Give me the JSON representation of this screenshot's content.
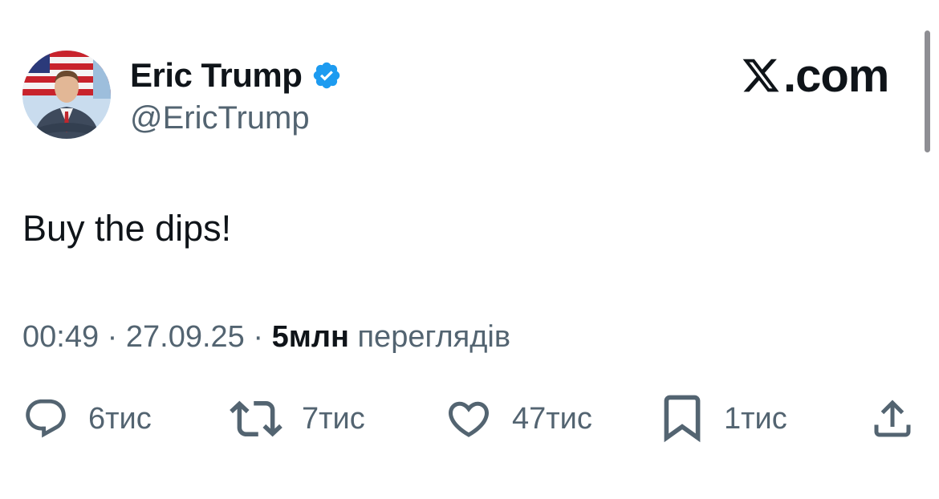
{
  "author": {
    "display_name": "Eric Trump",
    "handle": "@EricTrump",
    "verified": true
  },
  "brand": {
    "label": ".com"
  },
  "tweet": {
    "text": "Buy the dips!",
    "time": "00:49",
    "date": "27.09.25",
    "views_count": "5млн",
    "views_label": "переглядів",
    "separator": "·"
  },
  "actions": {
    "reply_count": "6тис",
    "retweet_count": "7тис",
    "like_count": "47тис",
    "bookmark_count": "1тис"
  },
  "colors": {
    "text_primary": "#0f1419",
    "text_secondary": "#536471",
    "verified_blue": "#1d9bf0"
  }
}
